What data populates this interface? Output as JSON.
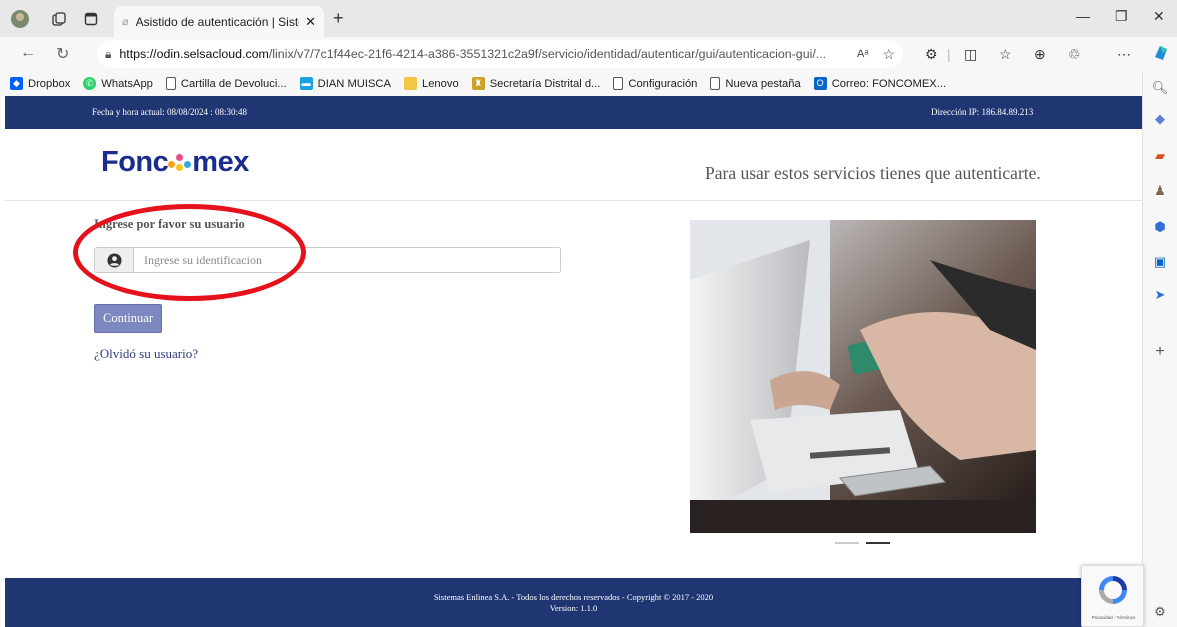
{
  "browser": {
    "tab_title": "Asistido de autenticación | Sisten",
    "url_host": "https://odin.selsacloud.com",
    "url_path": "/linix/v7/7c1f44ec-21f6-4214-a386-3551321c2a9f/servicio/identidad/autenticar/gui/autenticacion-gui/...",
    "read_aloud": "Aᵃ"
  },
  "bookmarks": [
    {
      "label": "Dropbox",
      "icon": "dropbox-icon",
      "color": "#0061fe"
    },
    {
      "label": "WhatsApp",
      "icon": "whatsapp-icon",
      "color": "#25d366"
    },
    {
      "label": "Cartilla de Devoluci...",
      "icon": "page-icon",
      "color": "#ffffff"
    },
    {
      "label": "DIAN MUISCA",
      "icon": "dian-icon",
      "color": "#1ba1e2"
    },
    {
      "label": "Lenovo",
      "icon": "folder-icon",
      "color": "#f2c744"
    },
    {
      "label": "Secretaría Distrital d...",
      "icon": "bogota-icon",
      "color": "#c9a227"
    },
    {
      "label": "Configuración",
      "icon": "page-icon",
      "color": "#ffffff"
    },
    {
      "label": "Nueva pestaña",
      "icon": "page-icon",
      "color": "#ffffff"
    },
    {
      "label": "Correo: FONCOMEX...",
      "icon": "outlook-icon",
      "color": "#0a64c9"
    }
  ],
  "page": {
    "datetime": "Fecha y hora actual: 08/08/2024 : 08:30:48",
    "ip": "Dirección IP: 186.84.89.213",
    "logo_left": "Fonc",
    "logo_right": "mex",
    "auth_message": "Para usar estos servicios tienes que autenticarte.",
    "prompt": "Ingrese por favor su usuario",
    "id_placeholder": "Ingrese su identificacion",
    "continue_label": "Continuar",
    "forgot_label": "¿Olvidó su usuario?",
    "footer_line1": "Sistemas Enlinea S.A. - Todos los derechos reservados - Copyright © 2017 - 2020",
    "footer_line2": "Version: 1.1.0",
    "recaptcha_terms": "Privacidad - Términos"
  },
  "colors": {
    "brand_navy": "#1f3673",
    "logo_blue": "#1a2c8e",
    "button": "#7d87c0",
    "annotation_red": "#e6121b"
  }
}
